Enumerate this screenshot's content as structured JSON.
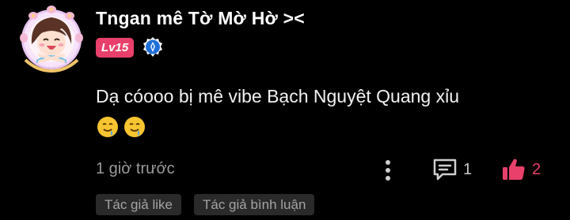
{
  "comment": {
    "username": "Tngan mê Tờ Mờ Hờ ><",
    "level": "Lv15",
    "text": "Dạ cóooo bị mê vibe Bạch Nguyệt Quang xỉu",
    "emoji_icons": [
      "drooling-smile-emoji",
      "drooling-smile-emoji"
    ],
    "time": "1 giờ trước",
    "reply_count": "1",
    "like_count": "2",
    "tags": [
      "Tác giả like",
      "Tác giả bình luận"
    ]
  },
  "colors": {
    "background": "#000000",
    "level_badge": "#e8406a",
    "like_accent": "#e8406a",
    "muted_text": "#9a9a9a",
    "tag_bg": "#2a2a2a"
  },
  "icons": {
    "avatar_frame": "flower-frame-icon",
    "verify": "verified-badge-icon",
    "more": "more-vertical-icon",
    "reply": "comment-icon",
    "like": "thumbs-up-icon"
  }
}
